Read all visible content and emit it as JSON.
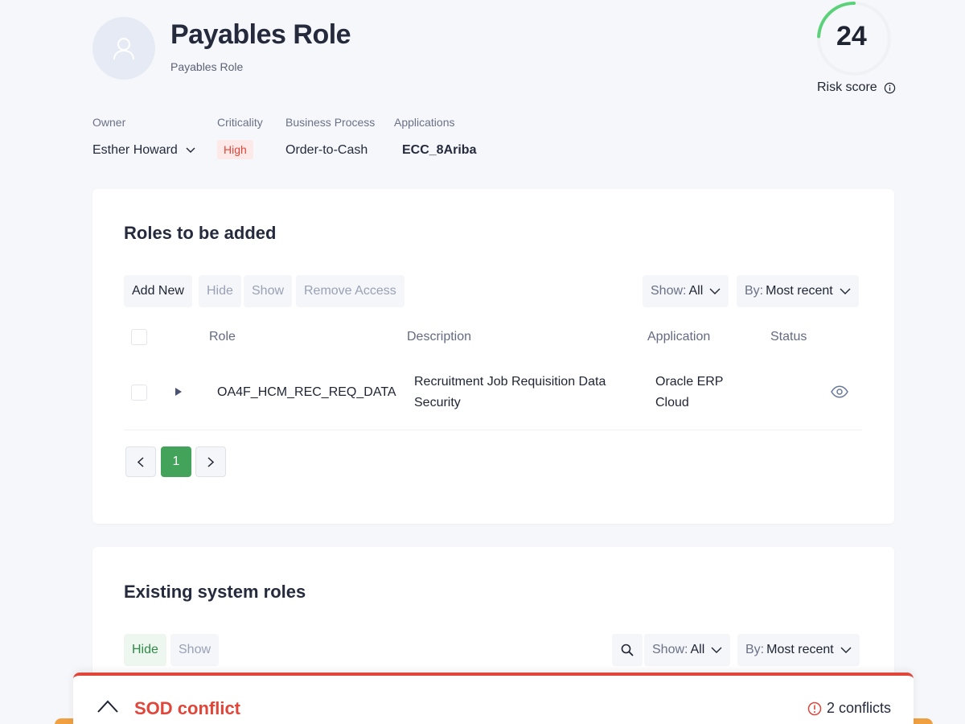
{
  "header": {
    "title": "Payables Role",
    "subtitle": "Payables Role",
    "avatar_icon": "user-icon",
    "risk_score": 24,
    "risk_fraction": 0.24,
    "risk_label": "Risk score",
    "risk_color": "#5bd27a"
  },
  "meta": {
    "owner_label": "Owner",
    "owner_value": "Esther Howard",
    "criticality_label": "Criticality",
    "criticality_value": "High",
    "business_process_label": "Business Process",
    "business_process_value": "Order-to-Cash",
    "applications_label": "Applications",
    "applications_value": "ECC_8Ariba"
  },
  "roles_to_add": {
    "title": "Roles to be added",
    "toolbar": {
      "add_new": "Add New",
      "hide": "Hide",
      "show": "Show",
      "remove_access": "Remove Access",
      "show_filter_label": "Show:",
      "show_filter_value": "All",
      "sort_label": "By:",
      "sort_value": "Most recent"
    },
    "columns": {
      "role": "Role",
      "description": "Description",
      "application": "Application",
      "status": "Status"
    },
    "rows": [
      {
        "role": "OA4F_HCM_REC_REQ_DATA",
        "description_line1": "Recruitment Job Requisition Data",
        "description_line2": "Security",
        "application_line1": "Oracle ERP",
        "application_line2": "Cloud",
        "status_icon": "eye-icon"
      }
    ],
    "pagination": {
      "current_page": "1"
    }
  },
  "existing_roles": {
    "title": "Existing system roles",
    "toolbar": {
      "hide": "Hide",
      "show": "Show",
      "show_filter_label": "Show:",
      "show_filter_value": "All",
      "sort_label": "By:",
      "sort_value": "Most recent"
    }
  },
  "sod_panel": {
    "title": "SOD conflict",
    "count_label": "2 conflicts",
    "accent_color": "#e0463a"
  }
}
